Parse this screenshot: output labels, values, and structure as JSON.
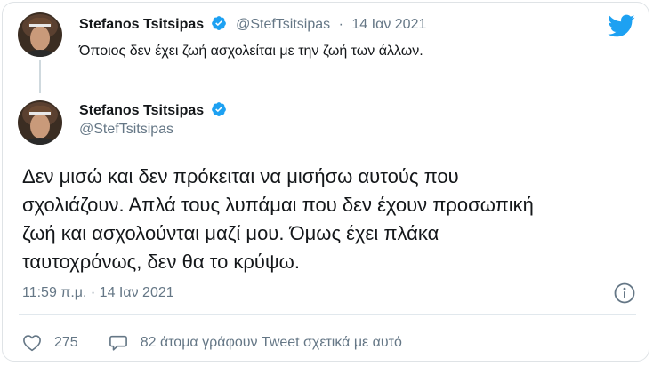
{
  "quoted_tweet": {
    "author_name": "Stefanos Tsitsipas",
    "handle": "@StefTsitsipas",
    "separator": "·",
    "date": "14 Ιαν 2021",
    "text": "Όποιος δεν έχει ζωή ασχολείται με την ζωή των άλλων."
  },
  "main_tweet": {
    "author_name": "Stefanos Tsitsipas",
    "handle": "@StefTsitsipas",
    "text_lines": [
      "Δεν μισώ και δεν πρόκειται να μισήσω αυτούς που",
      "σχολιάζουν. Απλά τους λυπάμαι που δεν έχουν προσωπική",
      "ζωή και ασχολούνται μαζί μου. Όμως έχει πλάκα",
      "ταυτοχρόνως, δεν θα το κρύψω."
    ],
    "timestamp": "11:59 π.μ. · 14 Ιαν 2021"
  },
  "actions": {
    "like_count": "275",
    "reply_text": "82 άτομα γράφουν Tweet σχετικά με αυτό"
  },
  "icons": {
    "brand": "twitter-bird-icon",
    "verified": "verified-badge-icon",
    "like": "heart-icon",
    "reply": "speech-bubble-icon",
    "info": "info-icon"
  },
  "colors": {
    "twitter_blue": "#1da1f2",
    "muted_text": "#657786",
    "primary_text": "#14171a",
    "border": "#dfe3e6"
  }
}
